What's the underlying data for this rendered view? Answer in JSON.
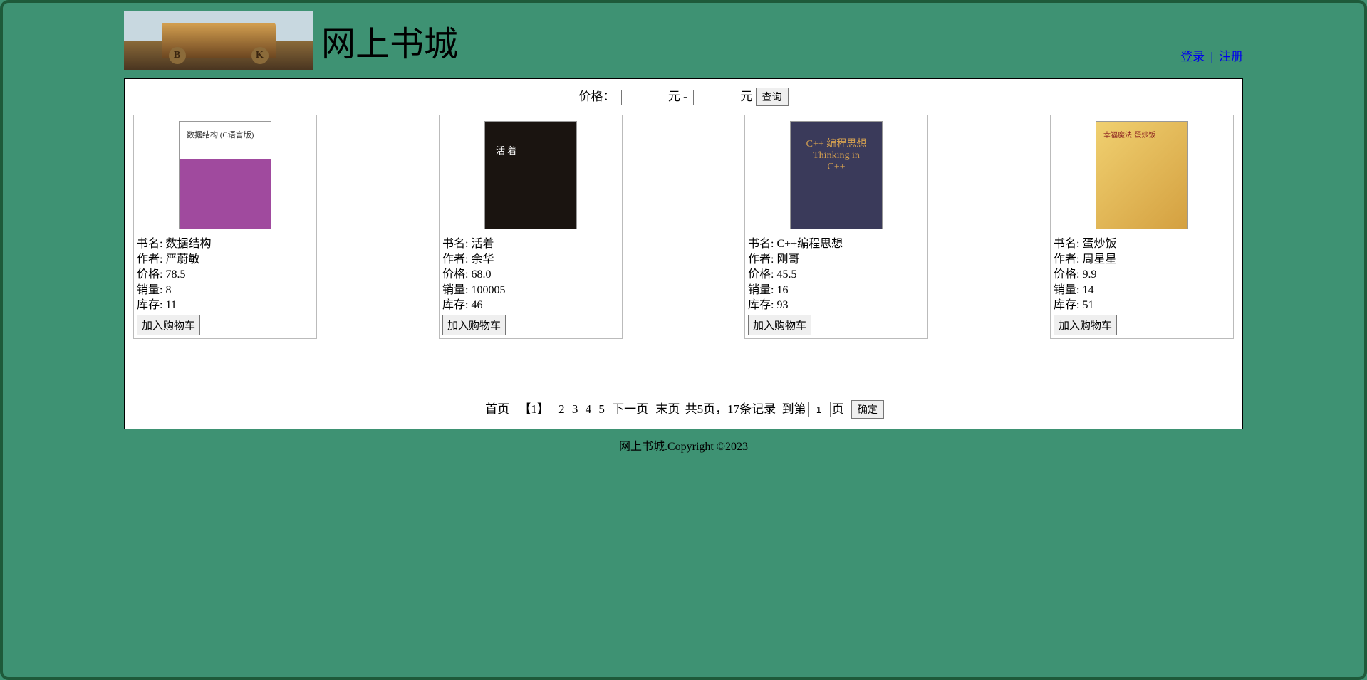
{
  "header": {
    "site_title": "网上书城",
    "auth": {
      "login": "登录",
      "separator": "|",
      "register": "注册"
    }
  },
  "filter": {
    "label": "价格：",
    "unit": "元",
    "dash": "-",
    "min": "",
    "max": "",
    "query_btn": "查询"
  },
  "labels": {
    "book_name": "书名:",
    "author": "作者:",
    "price": "价格:",
    "sales": "销量:",
    "stock": "库存:",
    "add_cart": "加入购物车"
  },
  "books": [
    {
      "name": "数据结构",
      "author": "严蔚敏",
      "price": "78.5",
      "sales": "8",
      "stock": "11",
      "cover_title": "数据结构\n(C语言版)"
    },
    {
      "name": "活着",
      "author": "余华",
      "price": "68.0",
      "sales": "100005",
      "stock": "46",
      "cover_title": "活 着"
    },
    {
      "name": "C++编程思想",
      "author": "刚哥",
      "price": "45.5",
      "sales": "16",
      "stock": "93",
      "cover_title": "C++\n编程思想\nThinking in C++"
    },
    {
      "name": "蛋炒饭",
      "author": "周星星",
      "price": "9.9",
      "sales": "14",
      "stock": "51",
      "cover_title": "幸福魔法·蛋炒饭"
    }
  ],
  "pagination": {
    "first": "首页",
    "current_page": "【1】",
    "pages": [
      "2",
      "3",
      "4",
      "5"
    ],
    "next": "下一页",
    "last": "末页",
    "summary": "共5页，17条记录",
    "goto_prefix": "到第",
    "goto_value": "1",
    "goto_suffix": "页",
    "confirm": "确定"
  },
  "footer": "网上书城.Copyright ©2023"
}
